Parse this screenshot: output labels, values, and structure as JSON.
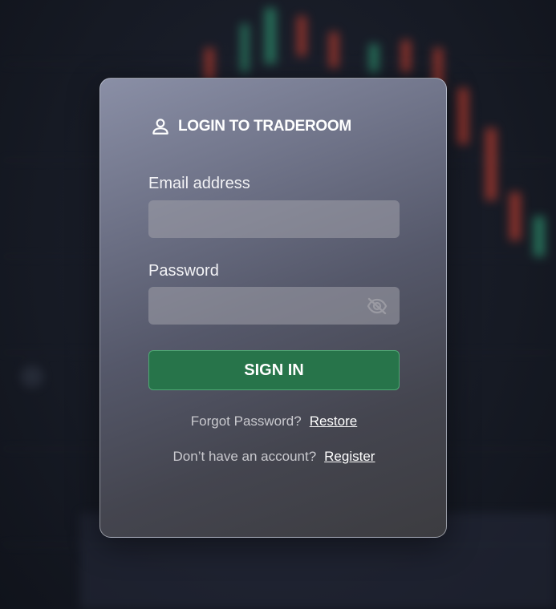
{
  "login": {
    "title": "LOGIN TO TRADEROOM",
    "email_label": "Email address",
    "email_value": "",
    "password_label": "Password",
    "password_value": "",
    "signin_label": "SIGN IN",
    "forgot_text": "Forgot Password?",
    "restore_link": "Restore",
    "no_account_text": "Don’t have an account?",
    "register_link": "Register"
  },
  "icons": {
    "user": "user-icon",
    "password_visibility": "eye-off-icon"
  },
  "colors": {
    "primary_button": "#27744a",
    "background": "#161a24",
    "candle_up": "#2c8b6a",
    "candle_down": "#c0392b"
  }
}
